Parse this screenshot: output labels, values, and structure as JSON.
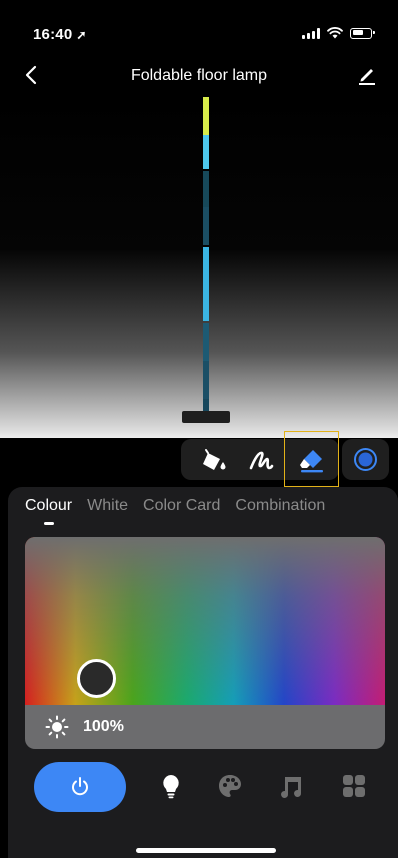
{
  "status_bar": {
    "time": "16:40",
    "location_arrow": "location-arrow-icon"
  },
  "header": {
    "title": "Foldable floor lamp",
    "back_icon": "chevron-left-icon",
    "edit_icon": "pencil-icon"
  },
  "lamp_preview": {
    "segment_colors": [
      "#d8ec4a",
      "#4ec8ec",
      "#17495a",
      "#1b4e63",
      "#3bb5e3",
      "#1d5a73",
      "#1b4f66",
      "#17475c"
    ]
  },
  "tools": [
    {
      "name": "paint-bucket-icon"
    },
    {
      "name": "brush-stroke-icon"
    },
    {
      "name": "eraser-icon",
      "selected": true
    },
    {
      "name": "color-ring-icon"
    }
  ],
  "tabs": [
    {
      "label": "Colour",
      "active": true
    },
    {
      "label": "White"
    },
    {
      "label": "Color Card"
    },
    {
      "label": "Combination"
    }
  ],
  "brightness": {
    "value": "100%"
  },
  "bottom_nav": {
    "power_color": "#3d87f5",
    "items": [
      "power-icon",
      "bulb-icon",
      "palette-icon",
      "music-icon",
      "scenes-icon"
    ]
  },
  "colors": {
    "accent": "#3d87f5",
    "highlight_box": "#e2b219"
  }
}
